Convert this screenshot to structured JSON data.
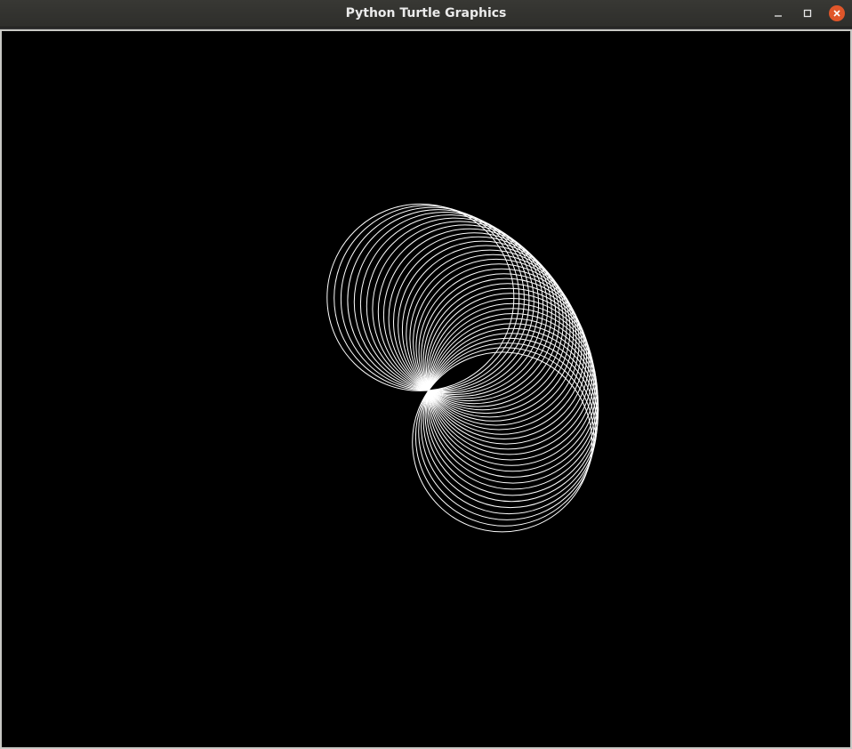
{
  "window": {
    "title": "Python Turtle Graphics",
    "controls": {
      "minimize_icon": "minimize-icon",
      "maximize_icon": "maximize-icon",
      "close_icon": "close-icon",
      "close_color": "#e0562a"
    }
  },
  "canvas": {
    "background": "#000000",
    "pen_color": "#ffffff"
  }
}
